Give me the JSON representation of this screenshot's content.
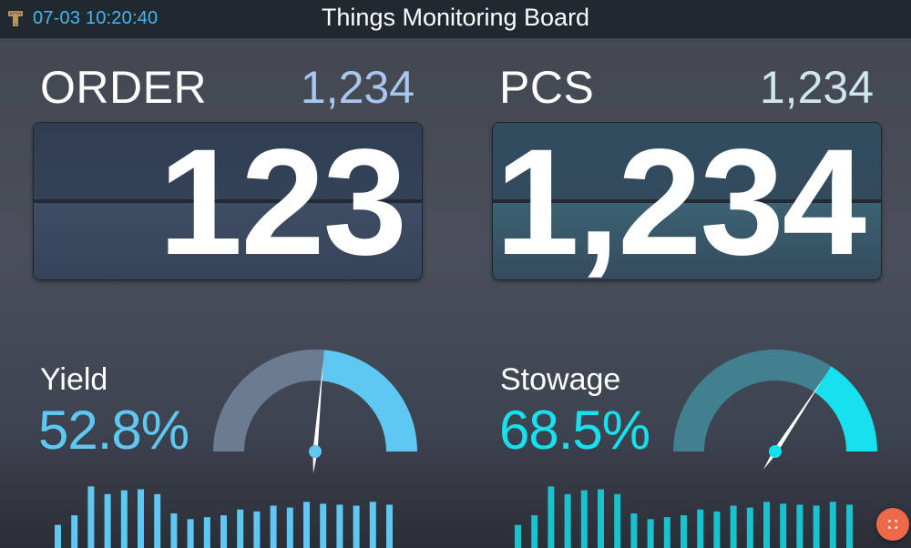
{
  "header": {
    "clock": "07-03 10:20:40",
    "title": "Things Monitoring Board"
  },
  "order": {
    "label": "ORDER",
    "target": "1,234",
    "value": "123",
    "target_color": "#a9c6ee"
  },
  "pcs": {
    "label": "PCS",
    "target": "1,234",
    "value": "1,234",
    "target_color": "#cfe6ee"
  },
  "yield": {
    "label": "Yield",
    "value_text": "52.8%",
    "percent": 52.8,
    "accent": "#5ec8f2",
    "track": "#6a7b92"
  },
  "stowage": {
    "label": "Stowage",
    "value_text": "68.5%",
    "percent": 68.5,
    "accent": "#17e1ee",
    "track": "#41808f"
  },
  "chart_data": [
    {
      "type": "bar",
      "values": [
        2.4,
        3.4,
        6.4,
        5.6,
        6.0,
        6.1,
        5.6,
        3.6,
        3.0,
        3.2,
        3.4,
        4.0,
        3.8,
        4.4,
        4.2,
        4.8,
        4.6,
        4.5,
        4.4,
        4.8,
        4.5
      ],
      "color": "#5ec8f2"
    },
    {
      "type": "bar",
      "values": [
        2.4,
        3.4,
        6.4,
        5.6,
        6.0,
        6.1,
        5.6,
        3.6,
        3.0,
        3.2,
        3.4,
        4.0,
        3.8,
        4.4,
        4.2,
        4.8,
        4.6,
        4.5,
        4.4,
        4.8,
        4.5
      ],
      "color": "#17c3cf"
    }
  ],
  "icons": {
    "logo": "board-logo-icon",
    "fab": "fullscreen-icon"
  }
}
